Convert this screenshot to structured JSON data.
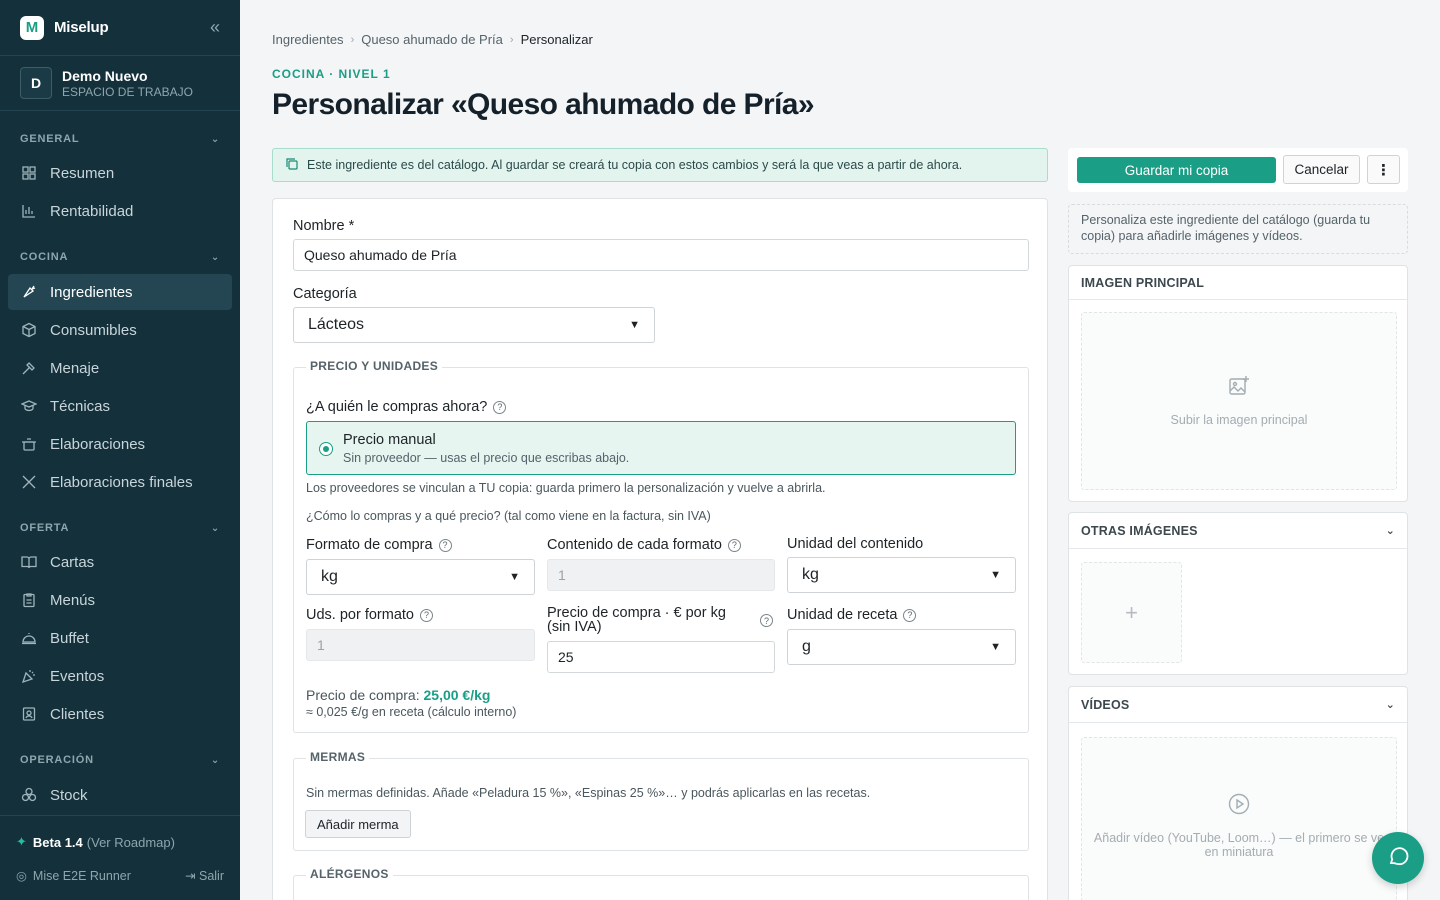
{
  "app": {
    "name": "Miselup",
    "logo_letter": "M",
    "collapse_icon": "«"
  },
  "workspace": {
    "avatar_letter": "D",
    "name": "Demo Nuevo",
    "subtitle": "ESPACIO DE TRABAJO"
  },
  "sidebar": {
    "sections": [
      {
        "label": "GENERAL",
        "items": [
          {
            "label": "Resumen",
            "icon": "grid-icon"
          },
          {
            "label": "Rentabilidad",
            "icon": "chart-icon"
          }
        ]
      },
      {
        "label": "COCINA",
        "items": [
          {
            "label": "Ingredientes",
            "icon": "carrot-icon",
            "active": true
          },
          {
            "label": "Consumibles",
            "icon": "box-icon"
          },
          {
            "label": "Menaje",
            "icon": "hammer-icon"
          },
          {
            "label": "Técnicas",
            "icon": "graduation-icon"
          },
          {
            "label": "Elaboraciones",
            "icon": "pot-icon"
          },
          {
            "label": "Elaboraciones finales",
            "icon": "utensils-icon"
          }
        ]
      },
      {
        "label": "OFERTA",
        "items": [
          {
            "label": "Cartas",
            "icon": "book-icon"
          },
          {
            "label": "Menús",
            "icon": "clipboard-icon"
          },
          {
            "label": "Buffet",
            "icon": "cloche-icon"
          },
          {
            "label": "Eventos",
            "icon": "party-icon"
          },
          {
            "label": "Clientes",
            "icon": "contact-icon"
          }
        ]
      },
      {
        "label": "OPERACIÓN",
        "items": [
          {
            "label": "Stock",
            "icon": "cubes-icon"
          }
        ]
      }
    ],
    "footer": {
      "beta": "Beta 1.4",
      "roadmap": "(Ver Roadmap)",
      "user": "Mise E2E Runner",
      "logout": "Salir"
    }
  },
  "breadcrumb": [
    "Ingredientes",
    "Queso ahumado de Pría",
    "Personalizar"
  ],
  "eyebrow": "COCINA · NIVEL 1",
  "title": "Personalizar «Queso ahumado de Pría»",
  "notice": "Este ingrediente es del catálogo. Al guardar se creará tu copia con estos cambios y será la que veas a partir de ahora.",
  "form": {
    "name_label": "Nombre *",
    "name_value": "Queso ahumado de Pría",
    "category_label": "Categoría",
    "category_value": "Lácteos",
    "price_section": {
      "legend": "PRECIO Y UNIDADES",
      "who_label": "¿A quién le compras ahora?",
      "radio_title": "Precio manual",
      "radio_sub": "Sin proveedor — usas el precio que escribas abajo.",
      "providers_note": "Los proveedores se vinculan a TU copia: guarda primero la personalización y vuelve a abrirla.",
      "how_note": "¿Cómo lo compras y a qué precio? (tal como viene en la factura, sin IVA)",
      "format_label": "Formato de compra",
      "format_value": "kg",
      "content_label": "Contenido de cada formato",
      "content_value": "1",
      "content_unit_label": "Unidad del contenido",
      "content_unit_value": "kg",
      "units_label": "Uds. por formato",
      "units_value": "1",
      "price_label": "Precio de compra · € por kg (sin IVA)",
      "price_value": "25",
      "recipe_unit_label": "Unidad de receta",
      "recipe_unit_value": "g",
      "price_summary_prefix": "Precio de compra:",
      "price_summary_value": "25,00 €/kg",
      "price_summary_recipe": "≈ 0,025 €/g en receta (cálculo interno)"
    },
    "mermas": {
      "legend": "MERMAS",
      "text": "Sin mermas definidas. Añade «Peladura 15 %», «Espinas 25 %»… y podrás aplicarlas en las recetas.",
      "button": "Añadir merma"
    },
    "alergenos": {
      "legend": "ALÉRGENOS"
    }
  },
  "actions": {
    "save": "Guardar mi copia",
    "cancel": "Cancelar",
    "more": "⋮"
  },
  "hint": "Personaliza este ingrediente del catálogo (guarda tu copia) para añadirle imágenes y vídeos.",
  "image_panel": {
    "title": "IMAGEN PRINCIPAL",
    "upload": "Subir la imagen principal"
  },
  "other_images_panel": {
    "title": "OTRAS IMÁGENES",
    "add": "+"
  },
  "videos_panel": {
    "title": "VÍDEOS",
    "add": "Añadir vídeo (YouTube, Loom…) — el primero se ve en miniatura"
  },
  "colors": {
    "accent": "#1a9e86",
    "sidebar": "#14303b"
  }
}
